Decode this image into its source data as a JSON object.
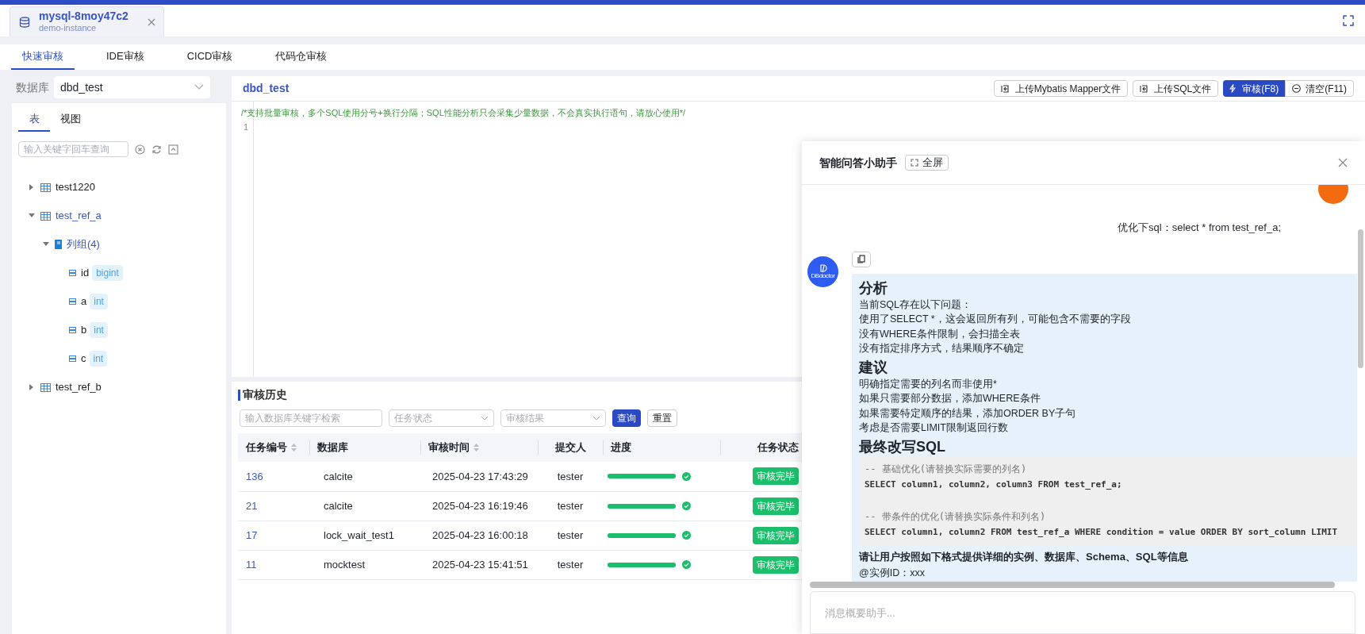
{
  "instance_tab": {
    "title": "mysql-8moy47c2",
    "subtitle": "demo-instance"
  },
  "review_tabs": [
    {
      "label": "快速审核",
      "selected": true
    },
    {
      "label": "IDE审核",
      "selected": false
    },
    {
      "label": "CICD审核",
      "selected": false
    },
    {
      "label": "代码仓审核",
      "selected": false
    }
  ],
  "sidebar": {
    "database_label": "数据库",
    "database_value": "dbd_test",
    "tabs": [
      {
        "label": "表",
        "selected": true
      },
      {
        "label": "视图",
        "selected": false
      }
    ],
    "search_placeholder": "输入关键字回车查询",
    "tree": [
      {
        "kind": "table",
        "label": "test1220",
        "expanded": false,
        "active": false
      },
      {
        "kind": "table",
        "label": "test_ref_a",
        "expanded": true,
        "active": true,
        "children": [
          {
            "kind": "group",
            "label": "列组(4)",
            "expanded": true,
            "active": true,
            "children": [
              {
                "kind": "column",
                "label": "id",
                "type": "bigint"
              },
              {
                "kind": "column",
                "label": "a",
                "type": "int"
              },
              {
                "kind": "column",
                "label": "b",
                "type": "int"
              },
              {
                "kind": "column",
                "label": "c",
                "type": "int"
              }
            ]
          }
        ]
      },
      {
        "kind": "table",
        "label": "test_ref_b",
        "expanded": false,
        "active": false
      }
    ]
  },
  "editor": {
    "database": "dbd_test",
    "buttons": [
      {
        "kind": "upload",
        "label": "上传Mybatis Mapper文件"
      },
      {
        "kind": "upload",
        "label": "上传SQL文件"
      },
      {
        "kind": "primary",
        "label": "审核(F8)"
      },
      {
        "kind": "clear",
        "label": "清空(F11)"
      }
    ],
    "hint_comment": "/*支持批量审核，多个SQL使用分号+换行分隔；SQL性能分析只会采集少量数据，不会真实执行语句，请放心使用*/",
    "line_numbers": [
      "1"
    ]
  },
  "history": {
    "title": "审核历史",
    "search_placeholder": "输入数据库关键字检索",
    "filters": [
      {
        "placeholder": "任务状态"
      },
      {
        "placeholder": "审核结果"
      }
    ],
    "buttons": [
      {
        "kind": "primary",
        "label": "查询"
      },
      {
        "kind": "default",
        "label": "重置"
      }
    ],
    "columns": [
      {
        "label": "任务编号",
        "sortable": true
      },
      {
        "label": "数据库",
        "sortable": false
      },
      {
        "label": "审核时间",
        "sortable": true
      },
      {
        "label": "提交人",
        "sortable": false
      },
      {
        "label": "进度",
        "sortable": false
      },
      {
        "label": "任务状态",
        "sortable": false
      }
    ],
    "rows": [
      {
        "id": "136",
        "database": "calcite",
        "time": "2025-04-23 17:43:29",
        "submitter": "tester",
        "level": 1,
        "status": "审核完毕"
      },
      {
        "id": "21",
        "database": "calcite",
        "time": "2025-04-23 16:19:46",
        "submitter": "tester",
        "level": 1,
        "status": "审核完毕"
      },
      {
        "id": "17",
        "database": "lock_wait_test1",
        "time": "2025-04-23 16:00:18",
        "submitter": "tester",
        "level": 1,
        "status": "审核完毕"
      },
      {
        "id": "11",
        "database": "mocktest",
        "time": "2025-04-23 15:41:51",
        "submitter": "tester",
        "level": 1,
        "status": "审核完毕"
      }
    ]
  },
  "assistant": {
    "title": "智能问答小助手",
    "fullscreen_button": "全屏",
    "user_message": "优化下sql：select * from test_ref_a;",
    "bot_avatar_label": "DBdoctor",
    "blocks": [
      {
        "kind": "heading",
        "text": "分析"
      },
      {
        "kind": "text",
        "text": "当前SQL存在以下问题："
      },
      {
        "kind": "text",
        "text": "使用了SELECT  *，这会返回所有列，可能包含不需要的字段"
      },
      {
        "kind": "text",
        "text": "没有WHERE条件限制，会扫描全表"
      },
      {
        "kind": "text",
        "text": "没有指定排序方式，结果顺序不确定"
      },
      {
        "kind": "heading",
        "text": "建议"
      },
      {
        "kind": "text",
        "text": "明确指定需要的列名而非使用*"
      },
      {
        "kind": "text",
        "text": "如果只需要部分数据，添加WHERE条件"
      },
      {
        "kind": "text",
        "text": "如果需要特定顺序的结果，添加ORDER BY子句"
      },
      {
        "kind": "text",
        "text": "考虑是否需要LIMIT限制返回行数"
      },
      {
        "kind": "heading",
        "text": "最终改写SQL"
      },
      {
        "kind": "code",
        "lines": [
          {
            "kind": "comment",
            "text": "-- 基础优化(请替换实际需要的列名)"
          },
          {
            "kind": "sql",
            "text": "SELECT column1, column2, column3 FROM test_ref_a;"
          },
          {
            "kind": "comment",
            "text": "-- 带条件的优化(请替换实际条件和列名)"
          },
          {
            "kind": "sql",
            "text": "SELECT column1, column2 FROM test_ref_a WHERE condition = value ORDER BY sort_column LIMIT"
          }
        ]
      },
      {
        "kind": "bold",
        "text": "请让用户按照如下格式提供详细的实例、数据库、Schema、SQL等信息"
      },
      {
        "kind": "text",
        "text": "@实例ID：xxx"
      }
    ],
    "input_placeholder": "消息概要助手..."
  }
}
